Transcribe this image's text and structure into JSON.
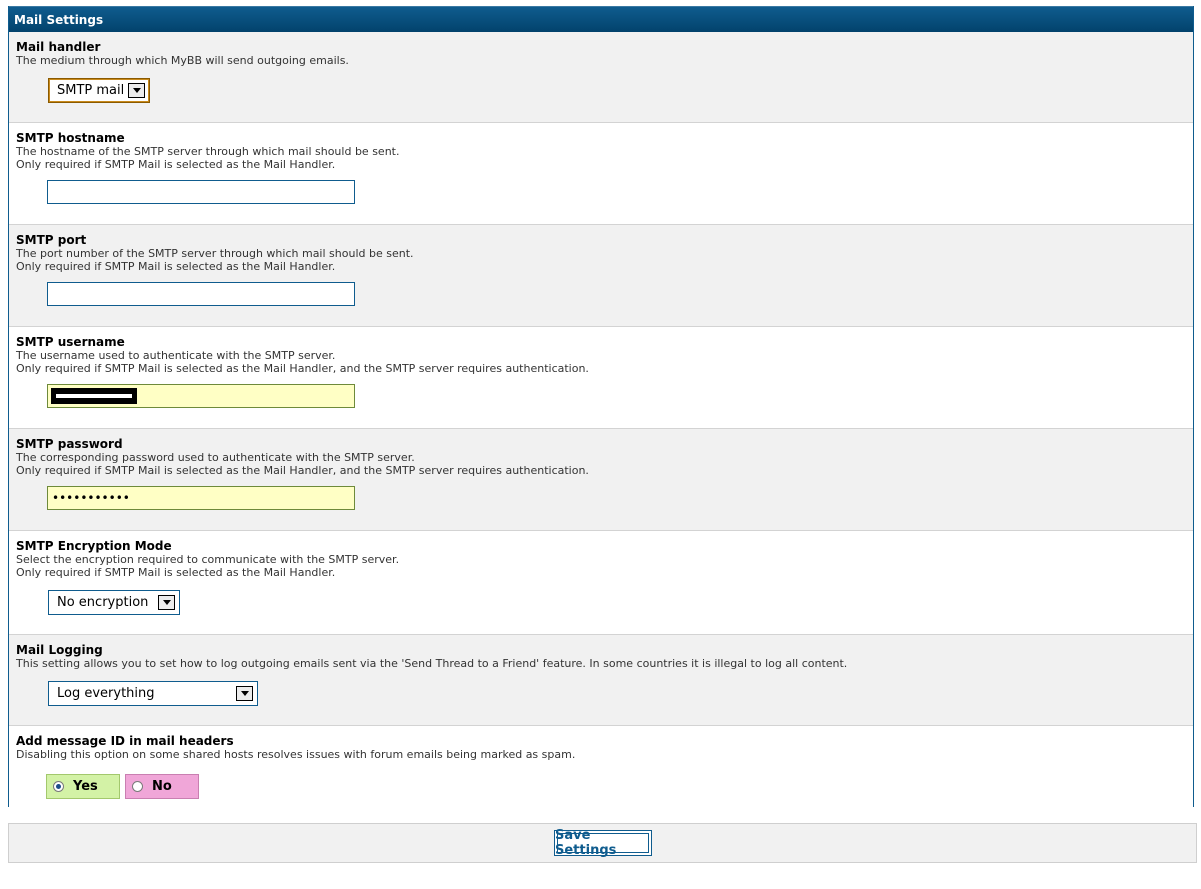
{
  "panel": {
    "title": "Mail Settings"
  },
  "settings": [
    {
      "title": "Mail handler",
      "desc": [
        "The medium through which MyBB will send outgoing emails."
      ],
      "control": {
        "type": "select",
        "value": "SMTP mail"
      }
    },
    {
      "title": "SMTP hostname",
      "desc": [
        "The hostname of the SMTP server through which mail should be sent.",
        "Only required if SMTP Mail is selected as the Mail Handler."
      ],
      "control": {
        "type": "text",
        "value": ""
      }
    },
    {
      "title": "SMTP port",
      "desc": [
        "The port number of the SMTP server through which mail should be sent.",
        "Only required if SMTP Mail is selected as the Mail Handler."
      ],
      "control": {
        "type": "text",
        "value": ""
      }
    },
    {
      "title": "SMTP username",
      "desc": [
        "The username used to authenticate with the SMTP server.",
        "Only required if SMTP Mail is selected as the Mail Handler, and the SMTP server requires authentication."
      ],
      "control": {
        "type": "text",
        "value": "",
        "redacted": true
      }
    },
    {
      "title": "SMTP password",
      "desc": [
        "The corresponding password used to authenticate with the SMTP server.",
        "Only required if SMTP Mail is selected as the Mail Handler, and the SMTP server requires authentication."
      ],
      "control": {
        "type": "password",
        "value": "•••••••••••"
      }
    },
    {
      "title": "SMTP Encryption Mode",
      "desc": [
        "Select the encryption required to communicate with the SMTP server.",
        "Only required if SMTP Mail is selected as the Mail Handler."
      ],
      "control": {
        "type": "select",
        "value": "No encryption"
      }
    },
    {
      "title": "Mail Logging",
      "desc": [
        "This setting allows you to set how to log outgoing emails sent via the 'Send Thread to a Friend' feature. In some countries it is illegal to log all content."
      ],
      "control": {
        "type": "select",
        "value": "Log everything"
      }
    },
    {
      "title": "Add message ID in mail headers",
      "desc": [
        "Disabling this option on some shared hosts resolves issues with forum emails being marked as spam."
      ],
      "control": {
        "type": "yesno",
        "yes_label": "Yes",
        "no_label": "No",
        "selected": "Yes"
      }
    }
  ],
  "footer": {
    "save_label": "Save Settings"
  },
  "colors": {
    "header": "#0f5c8e",
    "row_alt": "#ffffff",
    "row_base": "#f1f1f1",
    "filled_input": "#ffffc5",
    "yes_bg": "#d3f2a6",
    "no_bg": "#f0a6d8"
  },
  "icons": {
    "dropdown": "chevron-down-icon",
    "radio": "radio-icon"
  }
}
